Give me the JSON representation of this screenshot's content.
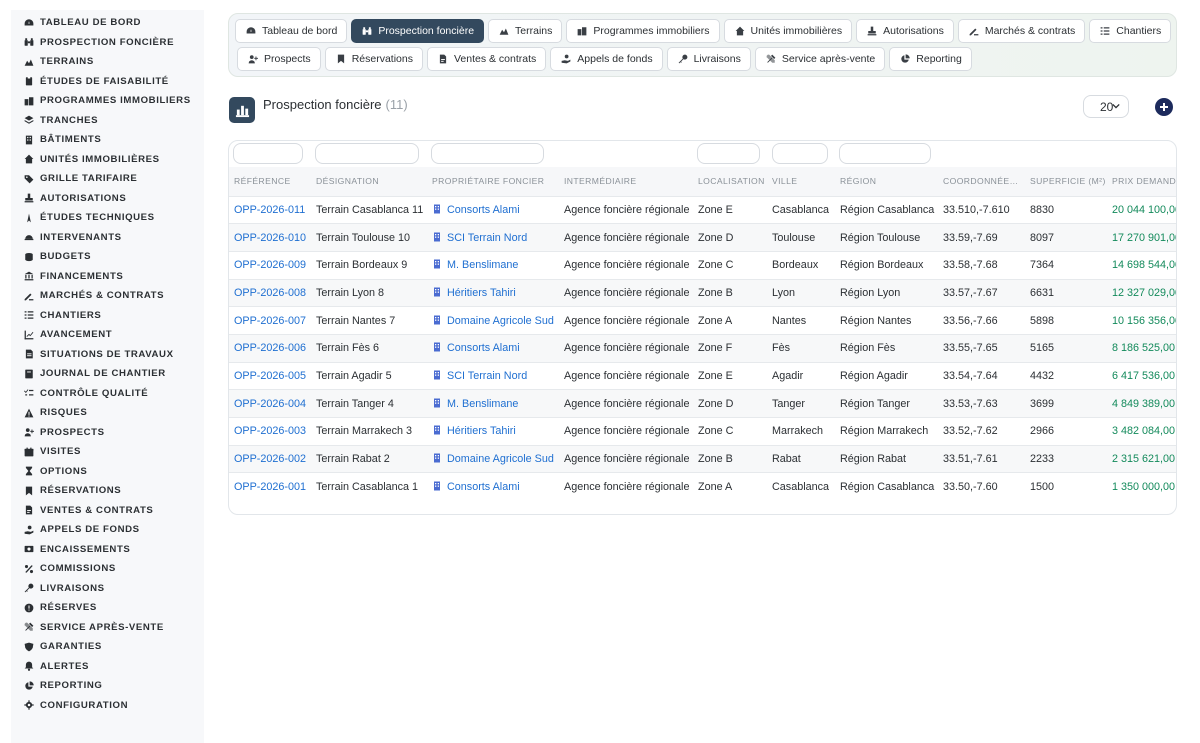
{
  "sidebar": {
    "items": [
      {
        "label": "TABLEAU DE BORD",
        "icon": "dashboard-icon"
      },
      {
        "label": "PROSPECTION FONCIÈRE",
        "icon": "binoculars-icon"
      },
      {
        "label": "TERRAINS",
        "icon": "land-icon"
      },
      {
        "label": "ÉTUDES DE FAISABILITÉ",
        "icon": "clipboard-icon"
      },
      {
        "label": "PROGRAMMES IMMOBILIERS",
        "icon": "buildings-icon"
      },
      {
        "label": "TRANCHES",
        "icon": "layers-icon"
      },
      {
        "label": "BÂTIMENTS",
        "icon": "building-icon"
      },
      {
        "label": "UNITÉS IMMOBILIÈRES",
        "icon": "home-icon"
      },
      {
        "label": "GRILLE TARIFAIRE",
        "icon": "tags-icon"
      },
      {
        "label": "AUTORISATIONS",
        "icon": "stamp-icon"
      },
      {
        "label": "ÉTUDES TECHNIQUES",
        "icon": "compass-icon"
      },
      {
        "label": "INTERVENANTS",
        "icon": "helmet-icon"
      },
      {
        "label": "BUDGETS",
        "icon": "coins-icon"
      },
      {
        "label": "FINANCEMENTS",
        "icon": "bank-icon"
      },
      {
        "label": "MARCHÉS & CONTRATS",
        "icon": "signature-icon"
      },
      {
        "label": "CHANTIERS",
        "icon": "tasks-icon"
      },
      {
        "label": "AVANCEMENT",
        "icon": "chart-line-icon"
      },
      {
        "label": "SITUATIONS DE TRAVAUX",
        "icon": "invoice-icon"
      },
      {
        "label": "JOURNAL DE CHANTIER",
        "icon": "book-icon"
      },
      {
        "label": "CONTRÔLE QUALITÉ",
        "icon": "check-list-icon"
      },
      {
        "label": "RISQUES",
        "icon": "warning-icon"
      },
      {
        "label": "PROSPECTS",
        "icon": "user-plus-icon"
      },
      {
        "label": "VISITES",
        "icon": "calendar-icon"
      },
      {
        "label": "OPTIONS",
        "icon": "hourglass-icon"
      },
      {
        "label": "RÉSERVATIONS",
        "icon": "bookmark-icon"
      },
      {
        "label": "VENTES & CONTRATS",
        "icon": "file-contract-icon"
      },
      {
        "label": "APPELS DE FONDS",
        "icon": "hand-holding-dollar-icon"
      },
      {
        "label": "ENCAISSEMENTS",
        "icon": "money-bill-icon"
      },
      {
        "label": "COMMISSIONS",
        "icon": "percent-icon"
      },
      {
        "label": "LIVRAISONS",
        "icon": "key-icon"
      },
      {
        "label": "RÉSERVES",
        "icon": "exclamation-circle-icon"
      },
      {
        "label": "SERVICE APRÈS-VENTE",
        "icon": "tools-icon"
      },
      {
        "label": "GARANTIES",
        "icon": "shield-icon"
      },
      {
        "label": "ALERTES",
        "icon": "bell-icon"
      },
      {
        "label": "REPORTING",
        "icon": "pie-chart-icon"
      },
      {
        "label": "CONFIGURATION",
        "icon": "gear-icon"
      }
    ]
  },
  "topnav": {
    "row1": [
      {
        "label": "Tableau de bord",
        "icon": "dashboard-icon",
        "active": false
      },
      {
        "label": "Prospection foncière",
        "icon": "binoculars-icon",
        "active": true
      },
      {
        "label": "Terrains",
        "icon": "land-icon",
        "active": false
      },
      {
        "label": "Programmes immobiliers",
        "icon": "buildings-icon",
        "active": false
      },
      {
        "label": "Unités immobilières",
        "icon": "home-icon",
        "active": false
      },
      {
        "label": "Autorisations",
        "icon": "stamp-icon",
        "active": false
      },
      {
        "label": "Marchés & contrats",
        "icon": "signature-icon",
        "active": false
      },
      {
        "label": "Chantiers",
        "icon": "tasks-icon",
        "active": false
      }
    ],
    "row2": [
      {
        "label": "Prospects",
        "icon": "user-plus-icon",
        "active": false
      },
      {
        "label": "Réservations",
        "icon": "bookmark-icon",
        "active": false
      },
      {
        "label": "Ventes & contrats",
        "icon": "file-contract-icon",
        "active": false
      },
      {
        "label": "Appels de fonds",
        "icon": "hand-holding-dollar-icon",
        "active": false
      },
      {
        "label": "Livraisons",
        "icon": "key-icon",
        "active": false
      },
      {
        "label": "Service après-vente",
        "icon": "tools-icon",
        "active": false
      },
      {
        "label": "Reporting",
        "icon": "pie-chart-icon",
        "active": false
      }
    ]
  },
  "header": {
    "title": "Prospection foncière",
    "count": "(11)",
    "per_page": "20"
  },
  "table": {
    "columns": [
      "RÉFÉRENCE",
      "DÉSIGNATION",
      "PROPRIÉTAIRE FONCIER",
      "INTERMÉDIAIRE",
      "LOCALISATION",
      "VILLE",
      "RÉGION",
      "COORDONNÉE…",
      "SUPERFICIE (M²)",
      "PRIX DEMANDÉ"
    ],
    "rows": [
      [
        "OPP-2026-011",
        "Terrain Casablanca 11",
        "Consorts Alami",
        "Agence foncière régionale",
        "Zone E",
        "Casablanca",
        "Région Casablanca",
        "33.510,-7.610",
        "8830",
        "20 044 100,00"
      ],
      [
        "OPP-2026-010",
        "Terrain Toulouse 10",
        "SCI Terrain Nord",
        "Agence foncière régionale",
        "Zone D",
        "Toulouse",
        "Région Toulouse",
        "33.59,-7.69",
        "8097",
        "17 270 901,00"
      ],
      [
        "OPP-2026-009",
        "Terrain Bordeaux 9",
        "M. Benslimane",
        "Agence foncière régionale",
        "Zone C",
        "Bordeaux",
        "Région Bordeaux",
        "33.58,-7.68",
        "7364",
        "14 698 544,00"
      ],
      [
        "OPP-2026-008",
        "Terrain Lyon 8",
        "Héritiers Tahiri",
        "Agence foncière régionale",
        "Zone B",
        "Lyon",
        "Région Lyon",
        "33.57,-7.67",
        "6631",
        "12 327 029,00"
      ],
      [
        "OPP-2026-007",
        "Terrain Nantes 7",
        "Domaine Agricole Sud",
        "Agence foncière régionale",
        "Zone A",
        "Nantes",
        "Région Nantes",
        "33.56,-7.66",
        "5898",
        "10 156 356,00"
      ],
      [
        "OPP-2026-006",
        "Terrain Fès 6",
        "Consorts Alami",
        "Agence foncière régionale",
        "Zone F",
        "Fès",
        "Région Fès",
        "33.55,-7.65",
        "5165",
        "8 186 525,00"
      ],
      [
        "OPP-2026-005",
        "Terrain Agadir 5",
        "SCI Terrain Nord",
        "Agence foncière régionale",
        "Zone E",
        "Agadir",
        "Région Agadir",
        "33.54,-7.64",
        "4432",
        "6 417 536,00"
      ],
      [
        "OPP-2026-004",
        "Terrain Tanger 4",
        "M. Benslimane",
        "Agence foncière régionale",
        "Zone D",
        "Tanger",
        "Région Tanger",
        "33.53,-7.63",
        "3699",
        "4 849 389,00"
      ],
      [
        "OPP-2026-003",
        "Terrain Marrakech 3",
        "Héritiers Tahiri",
        "Agence foncière régionale",
        "Zone C",
        "Marrakech",
        "Région Marrakech",
        "33.52,-7.62",
        "2966",
        "3 482 084,00"
      ],
      [
        "OPP-2026-002",
        "Terrain Rabat 2",
        "Domaine Agricole Sud",
        "Agence foncière régionale",
        "Zone B",
        "Rabat",
        "Région Rabat",
        "33.51,-7.61",
        "2233",
        "2 315 621,00"
      ],
      [
        "OPP-2026-001",
        "Terrain Casablanca 1",
        "Consorts Alami",
        "Agence foncière régionale",
        "Zone A",
        "Casablanca",
        "Région Casablanca",
        "33.50,-7.60",
        "1500",
        "1 350 000,00"
      ]
    ]
  },
  "colors": {
    "accent": "#33495e",
    "link": "#1f6fd1",
    "price": "#138a5b",
    "add_button": "#1c2a5c"
  }
}
